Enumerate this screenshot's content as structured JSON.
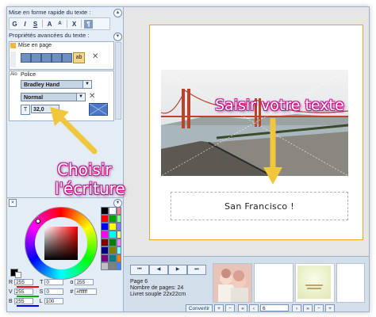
{
  "left_panel": {
    "quick_format_title": "Mise en forme rapide du texte :",
    "toolbar_buttons": [
      "G",
      "I",
      "S",
      "A",
      "A",
      "X",
      "¶"
    ],
    "advanced_title": "Propriétés avancées du texte :",
    "layout_label": "Mise en page",
    "layout_side_label": "ab",
    "font_label": "Police",
    "font_side_label": "Alo",
    "font_name": "Bradley Hand",
    "font_style": "Normal",
    "font_size": "32,0",
    "t_label": "T",
    "rgb": [
      {
        "label": "R",
        "value": "255",
        "t_label": "T",
        "t_value": "0",
        "x_label": "α",
        "x_value": "255"
      },
      {
        "label": "V",
        "value": "255",
        "t_label": "S",
        "t_value": "0",
        "x_label": "#",
        "x_value": "#ffffff"
      },
      {
        "label": "B",
        "value": "255",
        "t_label": "L",
        "t_value": "100",
        "x_label": "",
        "x_value": ""
      }
    ],
    "palette": [
      "#000000",
      "#ffffff",
      "#ff0000",
      "#00a000",
      "#0000ff",
      "#ffff00",
      "#ff00ff",
      "#00ffff",
      "#800000",
      "#008000",
      "#000080",
      "#808000",
      "#800080",
      "#008080",
      "#c0c0c0",
      "#808080",
      "#ff8080",
      "#80ff80",
      "#8080ff",
      "#ffff80",
      "#ff80ff",
      "#80ffff",
      "#ff8000",
      "#4080ff"
    ]
  },
  "canvas": {
    "text_content": "San Francisco !"
  },
  "bottom": {
    "page_label": "Page 6",
    "pages_count": "Nombre de pages: 24",
    "format_label": "Livret souple 22x22cm",
    "convert_label": "Convertir",
    "page_input": "6"
  },
  "annotations": {
    "top": "Saisir votre texte",
    "left_line1": "Choisir",
    "left_line2": "l'écriture"
  },
  "colors": {
    "accent": "#c0168c",
    "panel": "#e4ecf6",
    "page_border": "#e7a230"
  }
}
